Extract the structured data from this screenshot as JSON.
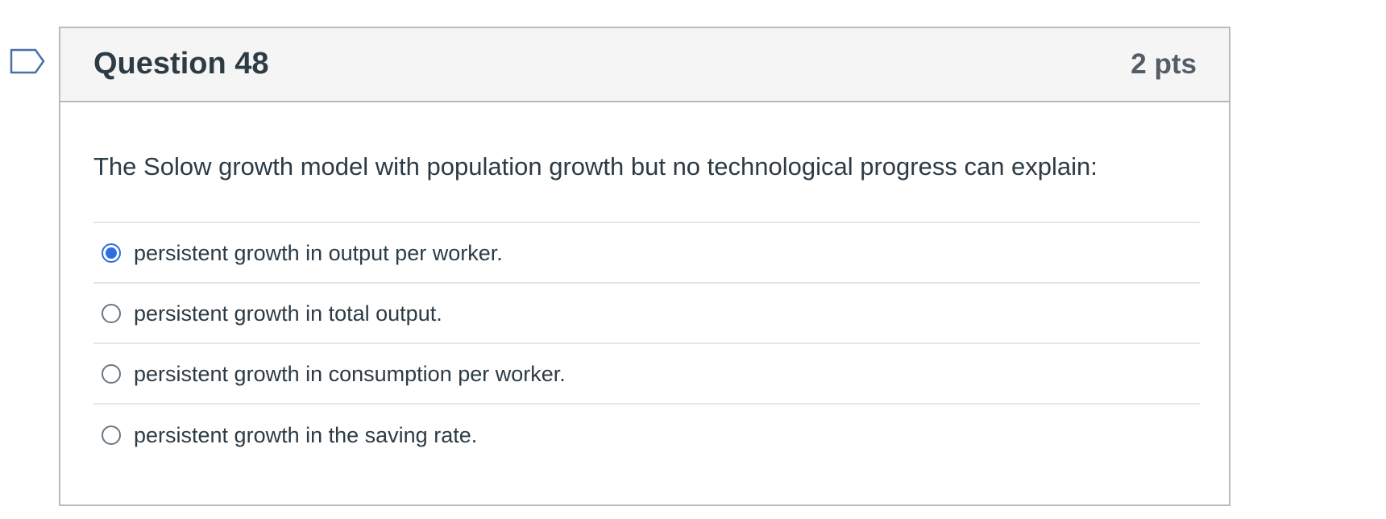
{
  "question": {
    "title": "Question 48",
    "points": "2 pts",
    "text": "The Solow growth model with population growth but no technological progress can explain:",
    "answers": [
      {
        "label": "persistent growth in output per worker.",
        "selected": true
      },
      {
        "label": "persistent growth in total output.",
        "selected": false
      },
      {
        "label": "persistent growth in consumption per worker.",
        "selected": false
      },
      {
        "label": "persistent growth in the saving rate.",
        "selected": false
      }
    ]
  },
  "icons": {
    "flag": "bookmark-flag-icon"
  },
  "colors": {
    "accent": "#2d6ee0",
    "header_bg": "#f5f5f5",
    "border": "#b5bbbf",
    "text": "#2d3b45"
  }
}
